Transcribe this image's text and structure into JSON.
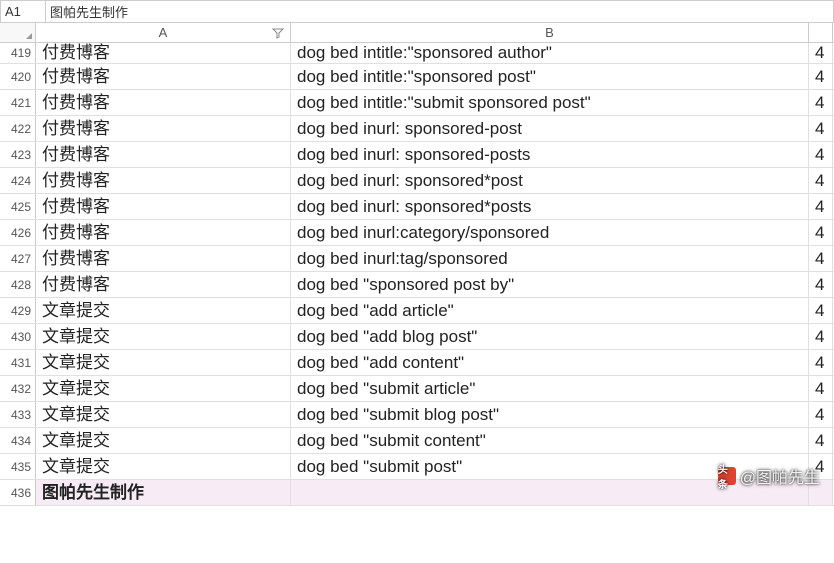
{
  "nameBox": {
    "cellRef": "A1",
    "value": "图帕先生制作"
  },
  "columns": {
    "a": "A",
    "b": "B"
  },
  "rows": [
    {
      "num": "419",
      "a": "付费博客",
      "b": "dog bed intitle:\"sponsored author\"",
      "c": "4"
    },
    {
      "num": "420",
      "a": "付费博客",
      "b": "dog bed intitle:\"sponsored post\"",
      "c": "4"
    },
    {
      "num": "421",
      "a": "付费博客",
      "b": "dog bed intitle:\"submit sponsored post\"",
      "c": "4"
    },
    {
      "num": "422",
      "a": "付费博客",
      "b": "dog bed inurl: sponsored-post",
      "c": "4"
    },
    {
      "num": "423",
      "a": "付费博客",
      "b": "dog bed inurl: sponsored-posts",
      "c": "4"
    },
    {
      "num": "424",
      "a": "付费博客",
      "b": "dog bed inurl: sponsored*post",
      "c": "4"
    },
    {
      "num": "425",
      "a": "付费博客",
      "b": "dog bed inurl: sponsored*posts",
      "c": "4"
    },
    {
      "num": "426",
      "a": "付费博客",
      "b": "dog bed inurl:category/sponsored",
      "c": "4"
    },
    {
      "num": "427",
      "a": "付费博客",
      "b": "dog bed inurl:tag/sponsored",
      "c": "4"
    },
    {
      "num": "428",
      "a": "付费博客",
      "b": "dog bed \"sponsored post by\"",
      "c": "4"
    },
    {
      "num": "429",
      "a": "文章提交",
      "b": "dog bed \"add article\"",
      "c": "4"
    },
    {
      "num": "430",
      "a": "文章提交",
      "b": "dog bed \"add blog post\"",
      "c": "4"
    },
    {
      "num": "431",
      "a": "文章提交",
      "b": "dog bed \"add content\"",
      "c": "4"
    },
    {
      "num": "432",
      "a": "文章提交",
      "b": "dog bed \"submit article\"",
      "c": "4"
    },
    {
      "num": "433",
      "a": "文章提交",
      "b": "dog bed \"submit blog post\"",
      "c": "4"
    },
    {
      "num": "434",
      "a": "文章提交",
      "b": "dog bed \"submit content\"",
      "c": "4"
    },
    {
      "num": "435",
      "a": "文章提交",
      "b": "dog bed \"submit post\"",
      "c": "4"
    },
    {
      "num": "436",
      "a": "图帕先生制作",
      "b": "",
      "c": "",
      "highlight": true
    }
  ],
  "watermark": {
    "label": "头条",
    "handle": "@图帕先生"
  }
}
